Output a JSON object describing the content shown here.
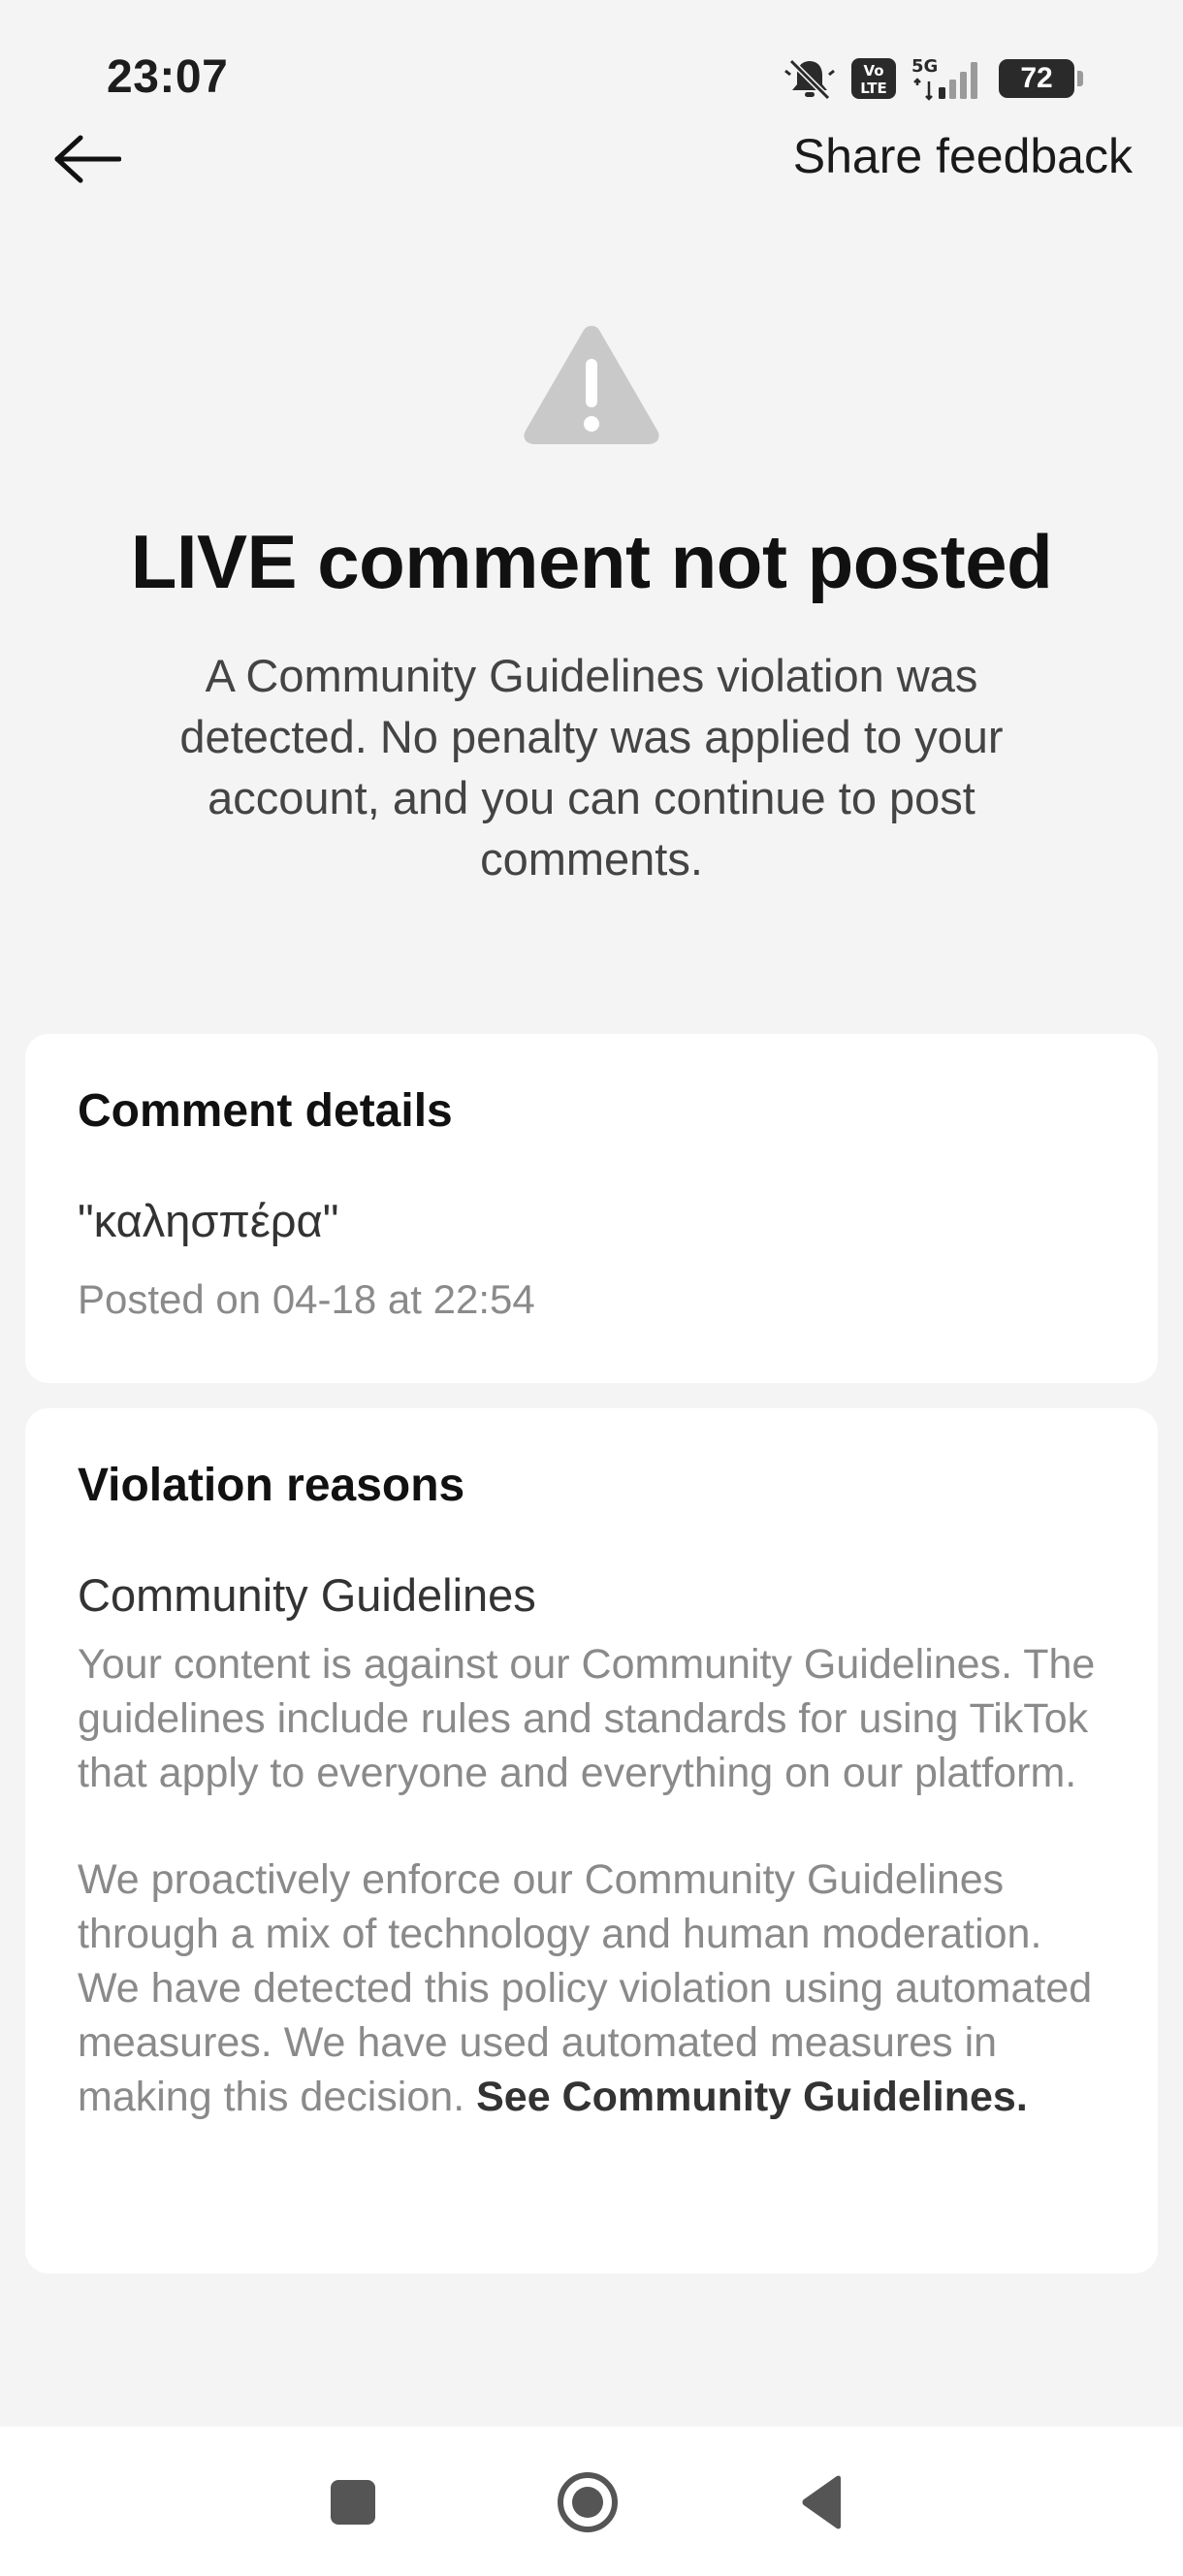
{
  "status_bar": {
    "time": "23:07",
    "network": "5G",
    "volte": "Vo LTE",
    "battery": "72"
  },
  "header": {
    "back_icon": "arrow-left-icon",
    "share_feedback_label": "Share feedback"
  },
  "hero": {
    "icon": "warning-triangle-icon",
    "title": "LIVE comment not posted",
    "subtitle": "A Community Guidelines violation was detected. No penalty was applied to your account, and you can continue to post comments."
  },
  "comment_details": {
    "heading": "Comment details",
    "comment": "\"καλησπέρα\"",
    "posted_on": "Posted on 04-18 at 22:54"
  },
  "violation": {
    "heading": "Violation reasons",
    "reason_title": "Community Guidelines",
    "paragraph1": "Your content is against our Community Guidelines. The guidelines include rules and standards for using TikTok that apply to everyone and everything on our platform.",
    "paragraph2": "We proactively enforce our Community Guidelines through a mix of technology and human moderation. We have detected this policy violation using automated measures. We have used automated measures in making this decision.",
    "link_label": "See Community Guidelines."
  },
  "nav_bar": {
    "recents_icon": "square-icon",
    "home_icon": "circle-home-icon",
    "back_icon": "triangle-back-icon"
  },
  "colors": {
    "background": "#f4f4f4",
    "card": "#ffffff",
    "warning_icon": "#c9c9c9",
    "muted_text": "#8a8a8a"
  }
}
